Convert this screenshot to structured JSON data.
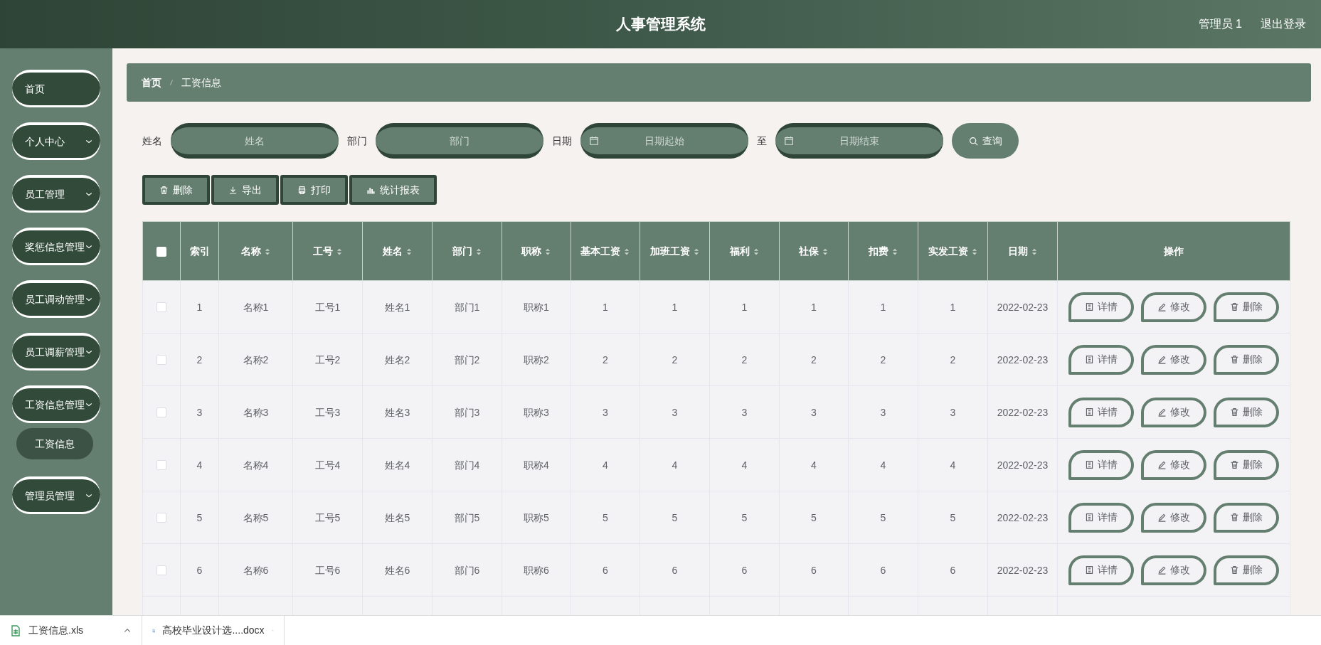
{
  "header": {
    "title": "人事管理系统",
    "user": "管理员 1",
    "logout": "退出登录"
  },
  "sidebar": {
    "items": [
      {
        "label": "首页",
        "expandable": false,
        "selected": false
      },
      {
        "label": "个人中心",
        "expandable": true,
        "selected": false
      },
      {
        "label": "员工管理",
        "expandable": true,
        "selected": false
      },
      {
        "label": "奖惩信息管理",
        "expandable": true,
        "selected": false
      },
      {
        "label": "员工调动管理",
        "expandable": true,
        "selected": false
      },
      {
        "label": "员工调薪管理",
        "expandable": true,
        "selected": false
      },
      {
        "label": "工资信息管理",
        "expandable": true,
        "selected": false,
        "children": [
          {
            "label": "工资信息",
            "selected": true
          }
        ]
      },
      {
        "label": "管理员管理",
        "expandable": true,
        "selected": false
      }
    ]
  },
  "breadcrumb": [
    "首页",
    "工资信息"
  ],
  "search": {
    "fields": [
      {
        "label": "姓名",
        "placeholder": "姓名",
        "kind": "text"
      },
      {
        "label": "部门",
        "placeholder": "部门",
        "kind": "text"
      },
      {
        "label": "日期",
        "placeholder": "日期起始",
        "kind": "date"
      },
      {
        "label": "至",
        "placeholder": "日期结束",
        "kind": "date"
      }
    ],
    "button": "查询"
  },
  "toolbar": [
    "删除",
    "导出",
    "打印",
    "统计报表"
  ],
  "table": {
    "select_all": {
      "checked": false
    },
    "columns": [
      {
        "label": "索引",
        "sortable": false
      },
      {
        "label": "名称",
        "sortable": true
      },
      {
        "label": "工号",
        "sortable": true
      },
      {
        "label": "姓名",
        "sortable": true
      },
      {
        "label": "部门",
        "sortable": true
      },
      {
        "label": "职称",
        "sortable": true
      },
      {
        "label": "基本工资",
        "sortable": true
      },
      {
        "label": "加班工资",
        "sortable": true
      },
      {
        "label": "福利",
        "sortable": true
      },
      {
        "label": "社保",
        "sortable": true
      },
      {
        "label": "扣费",
        "sortable": true
      },
      {
        "label": "实发工资",
        "sortable": true
      },
      {
        "label": "日期",
        "sortable": true
      },
      {
        "label": "操作",
        "sortable": false
      }
    ],
    "rows": [
      {
        "checked": false,
        "cells": [
          "1",
          "名称1",
          "工号1",
          "姓名1",
          "部门1",
          "职称1",
          "1",
          "1",
          "1",
          "1",
          "1",
          "1",
          "2022-02-23"
        ],
        "actions": [
          "详情",
          "修改",
          "删除"
        ]
      },
      {
        "checked": false,
        "cells": [
          "2",
          "名称2",
          "工号2",
          "姓名2",
          "部门2",
          "职称2",
          "2",
          "2",
          "2",
          "2",
          "2",
          "2",
          "2022-02-23"
        ],
        "actions": [
          "详情",
          "修改",
          "删除"
        ]
      },
      {
        "checked": false,
        "cells": [
          "3",
          "名称3",
          "工号3",
          "姓名3",
          "部门3",
          "职称3",
          "3",
          "3",
          "3",
          "3",
          "3",
          "3",
          "2022-02-23"
        ],
        "actions": [
          "详情",
          "修改",
          "删除"
        ]
      },
      {
        "checked": false,
        "cells": [
          "4",
          "名称4",
          "工号4",
          "姓名4",
          "部门4",
          "职称4",
          "4",
          "4",
          "4",
          "4",
          "4",
          "4",
          "2022-02-23"
        ],
        "actions": [
          "详情",
          "修改",
          "删除"
        ]
      },
      {
        "checked": false,
        "cells": [
          "5",
          "名称5",
          "工号5",
          "姓名5",
          "部门5",
          "职称5",
          "5",
          "5",
          "5",
          "5",
          "5",
          "5",
          "2022-02-23"
        ],
        "actions": [
          "详情",
          "修改",
          "删除"
        ]
      },
      {
        "checked": false,
        "cells": [
          "6",
          "名称6",
          "工号6",
          "姓名6",
          "部门6",
          "职称6",
          "6",
          "6",
          "6",
          "6",
          "6",
          "6",
          "2022-02-23"
        ],
        "actions": [
          "详情",
          "修改",
          "删除"
        ]
      }
    ]
  },
  "downloads": [
    {
      "name": "工资信息.xls",
      "kind": "sheet"
    },
    {
      "name": "高校毕业设计选....docx",
      "kind": "word"
    }
  ]
}
